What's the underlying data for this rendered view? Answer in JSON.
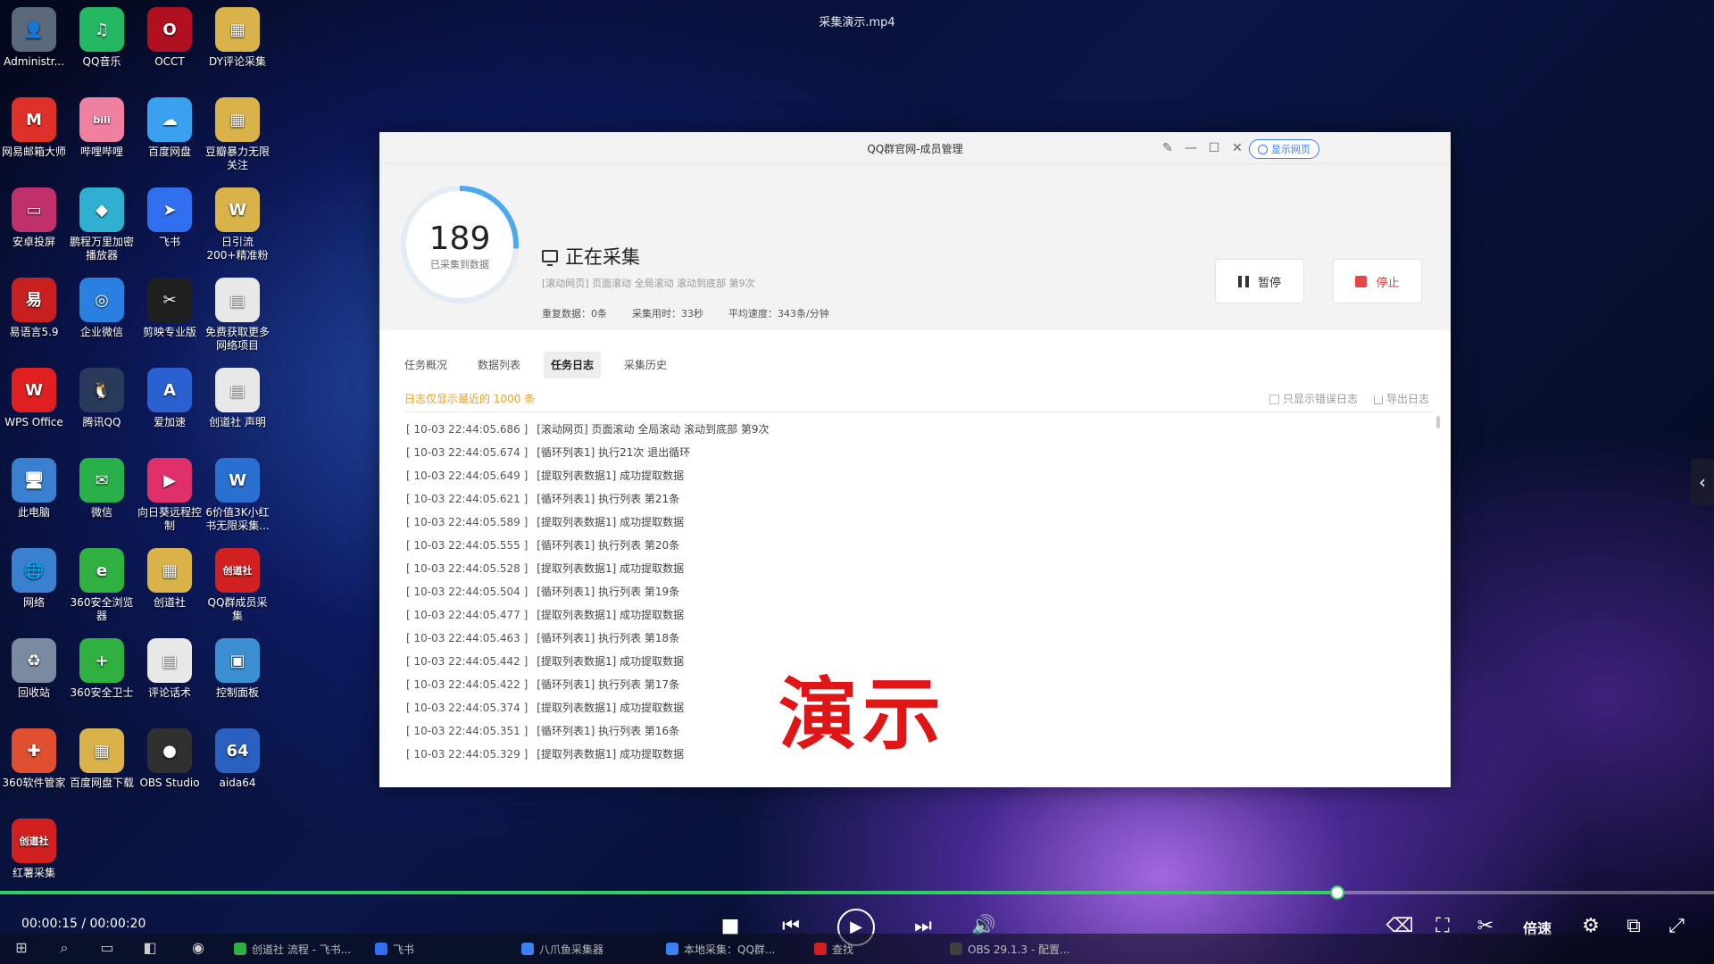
{
  "video": {
    "title": "采集演示.mp4",
    "time": "00:00:15 / 00:00:20",
    "progress": 0.78,
    "speed_label": "倍速"
  },
  "desktop_icons": [
    {
      "label": "Administr...",
      "glyph": "👤",
      "color": "#5a6a7a"
    },
    {
      "label": "QQ音乐",
      "glyph": "♫",
      "color": "#25b863"
    },
    {
      "label": "OCCT",
      "glyph": "O",
      "color": "#b01020"
    },
    {
      "label": "DY评论采集",
      "glyph": "▦",
      "color": "#d9b34a"
    },
    {
      "label": "网易邮箱大师",
      "glyph": "M",
      "color": "#e0302a"
    },
    {
      "label": "哔哩哔哩",
      "glyph": "bili",
      "color": "#f080a0"
    },
    {
      "label": "百度网盘",
      "glyph": "☁",
      "color": "#3aa0f0"
    },
    {
      "label": "豆瓣暴力无限关注",
      "glyph": "▦",
      "color": "#d9b34a"
    },
    {
      "label": "安卓投屏",
      "glyph": "▭",
      "color": "#c0306a"
    },
    {
      "label": "鹏程万里加密播放器",
      "glyph": "◆",
      "color": "#30b0d0"
    },
    {
      "label": "飞书",
      "glyph": "➤",
      "color": "#3070f0"
    },
    {
      "label": "日引流200+精准粉",
      "glyph": "W",
      "color": "#d9b34a"
    },
    {
      "label": "易语言5.9",
      "glyph": "易",
      "color": "#c82020"
    },
    {
      "label": "企业微信",
      "glyph": "◎",
      "color": "#2a80e0"
    },
    {
      "label": "剪映专业版",
      "glyph": "✂",
      "color": "#202020"
    },
    {
      "label": "免费获取更多网络项目",
      "glyph": "▤",
      "color": "#e8e8e8"
    },
    {
      "label": "WPS Office",
      "glyph": "W",
      "color": "#e02020"
    },
    {
      "label": "腾讯QQ",
      "glyph": "🐧",
      "color": "#2a3a5a"
    },
    {
      "label": "爱加速",
      "glyph": "A",
      "color": "#2a60d0"
    },
    {
      "label": "创道社 声明",
      "glyph": "▤",
      "color": "#e8e8e8"
    },
    {
      "label": "此电脑",
      "glyph": "🖥",
      "color": "#3a80d0"
    },
    {
      "label": "微信",
      "glyph": "✉",
      "color": "#2ab04a"
    },
    {
      "label": "向日葵远程控制",
      "glyph": "▶",
      "color": "#e0306a"
    },
    {
      "label": "6价值3K小红书无限采集...",
      "glyph": "W",
      "color": "#2a70d0"
    },
    {
      "label": "网络",
      "glyph": "🌐",
      "color": "#3a80d0"
    },
    {
      "label": "360安全浏览器",
      "glyph": "e",
      "color": "#30b040"
    },
    {
      "label": "创道社",
      "glyph": "▦",
      "color": "#d9b34a"
    },
    {
      "label": "QQ群成员采集",
      "glyph": "创道社",
      "color": "#d02020"
    },
    {
      "label": "回收站",
      "glyph": "♻",
      "color": "#7a8aa0"
    },
    {
      "label": "360安全卫士",
      "glyph": "+",
      "color": "#30b040"
    },
    {
      "label": "评论话术",
      "glyph": "▤",
      "color": "#e8e8e8"
    },
    {
      "label": "控制面板",
      "glyph": "▣",
      "color": "#3a90d0"
    },
    {
      "label": "360软件管家",
      "glyph": "✚",
      "color": "#e05030"
    },
    {
      "label": "百度网盘下载",
      "glyph": "▦",
      "color": "#d9b34a"
    },
    {
      "label": "OBS Studio",
      "glyph": "●",
      "color": "#303030"
    },
    {
      "label": "aida64",
      "glyph": "64",
      "color": "#2a60c0"
    },
    {
      "label": "红薯采集",
      "glyph": "创道社",
      "color": "#d02020"
    }
  ],
  "window": {
    "title": "QQ群官网-成员管理",
    "show_web_label": "显示网页",
    "collected_count": "189",
    "collected_label": "已采集到数据",
    "progress": 0.26,
    "status": "正在采集",
    "current_action": "[滚动网页] 页面滚动 全局滚动 滚动到底部 第9次",
    "stats": {
      "duplicate": "重复数据：0条",
      "elapsed": "采集用时：33秒",
      "speed": "平均速度：343条/分钟"
    },
    "pause_label": "暂停",
    "stop_label": "停止"
  },
  "tabs": [
    {
      "label": "任务概况",
      "active": false
    },
    {
      "label": "数据列表",
      "active": false
    },
    {
      "label": "任务日志",
      "active": true
    },
    {
      "label": "采集历史",
      "active": false
    }
  ],
  "log": {
    "notice": "日志仅显示最近的 1000 条",
    "only_errors_label": "只显示错误日志",
    "export_label": "导出日志",
    "entries": [
      {
        "ts": "[ 10-03 22:44:05.686 ]",
        "msg": "[滚动网页] 页面滚动 全局滚动 滚动到底部 第9次"
      },
      {
        "ts": "[ 10-03 22:44:05.674 ]",
        "msg": "[循环列表1] 执行21次 退出循环"
      },
      {
        "ts": "[ 10-03 22:44:05.649 ]",
        "msg": "[提取列表数据1] 成功提取数据"
      },
      {
        "ts": "[ 10-03 22:44:05.621 ]",
        "msg": "[循环列表1] 执行列表 第21条"
      },
      {
        "ts": "[ 10-03 22:44:05.589 ]",
        "msg": "[提取列表数据1] 成功提取数据"
      },
      {
        "ts": "[ 10-03 22:44:05.555 ]",
        "msg": "[循环列表1] 执行列表 第20条"
      },
      {
        "ts": "[ 10-03 22:44:05.528 ]",
        "msg": "[提取列表数据1] 成功提取数据"
      },
      {
        "ts": "[ 10-03 22:44:05.504 ]",
        "msg": "[循环列表1] 执行列表 第19条"
      },
      {
        "ts": "[ 10-03 22:44:05.477 ]",
        "msg": "[提取列表数据1] 成功提取数据"
      },
      {
        "ts": "[ 10-03 22:44:05.463 ]",
        "msg": "[循环列表1] 执行列表 第18条"
      },
      {
        "ts": "[ 10-03 22:44:05.442 ]",
        "msg": "[提取列表数据1] 成功提取数据"
      },
      {
        "ts": "[ 10-03 22:44:05.422 ]",
        "msg": "[循环列表1] 执行列表 第17条"
      },
      {
        "ts": "[ 10-03 22:44:05.374 ]",
        "msg": "[提取列表数据1] 成功提取数据"
      },
      {
        "ts": "[ 10-03 22:44:05.351 ]",
        "msg": "[循环列表1] 执行列表 第16条"
      },
      {
        "ts": "[ 10-03 22:44:05.329 ]",
        "msg": "[提取列表数据1] 成功提取数据"
      }
    ]
  },
  "watermark": "演示",
  "taskbar": {
    "tasks": [
      {
        "label": "创道社 流程 - 飞书...",
        "color": "#30b040"
      },
      {
        "label": "飞书",
        "color": "#3070f0"
      },
      {
        "label": "八爪鱼采集器",
        "color": "#3a80f0"
      },
      {
        "label": "本地采集：QQ群...",
        "color": "#3a80f0"
      },
      {
        "label": "查找",
        "color": "#d02020"
      },
      {
        "label": "OBS 29.1.3 - 配置...",
        "color": "#404040"
      }
    ]
  },
  "colors": {
    "accent": "#3d7cf0",
    "ring": "#4da8ee",
    "stop": "#e23b3b",
    "notice": "#f0a020",
    "progress": "#2fd060"
  }
}
